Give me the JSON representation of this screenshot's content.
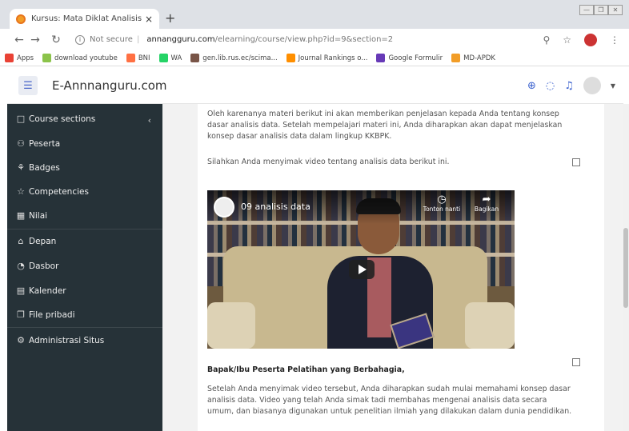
{
  "browser": {
    "tab_title": "Kursus: Mata Diklat Analisis dan",
    "tab_close": "×",
    "new_tab": "+",
    "url_security": "Not secure",
    "url_domain": "annangguru.com",
    "url_path": "/elearning/course/view.php?id=9&section=2",
    "bookmarks": [
      {
        "label": "Apps",
        "color": "#e94235"
      },
      {
        "label": "download youtube",
        "color": "#8bc34a"
      },
      {
        "label": "BNI",
        "color": "#ff7043"
      },
      {
        "label": "WA",
        "color": "#25d366"
      },
      {
        "label": "gen.lib.rus.ec/scima...",
        "color": "#795548"
      },
      {
        "label": "Journal Rankings o...",
        "color": "#ff8f00"
      },
      {
        "label": "Google Formulir",
        "color": "#673ab7"
      },
      {
        "label": "MD-APDK",
        "color": "#f29d27"
      }
    ]
  },
  "navbar": {
    "brand": "E-Annnanguru.com"
  },
  "sidebar": {
    "items": [
      {
        "label": "Course sections",
        "icon": "□"
      },
      {
        "label": "Peserta",
        "icon": "⚇"
      },
      {
        "label": "Badges",
        "icon": "⚘"
      },
      {
        "label": "Competencies",
        "icon": "☆"
      },
      {
        "label": "Nilai",
        "icon": "▦"
      },
      {
        "label": "Depan",
        "icon": "⌂"
      },
      {
        "label": "Dasbor",
        "icon": "◔"
      },
      {
        "label": "Kalender",
        "icon": "▤"
      },
      {
        "label": "File pribadi",
        "icon": "❐"
      },
      {
        "label": "Administrasi Situs",
        "icon": "⚙"
      }
    ]
  },
  "content": {
    "para1": "Oleh karenanya materi berikut ini akan memberikan penjelasan kepada Anda tentang konsep dasar analisis data. Setelah mempelajari materi ini, Anda diharapkan akan dapat menjelaskan konsep dasar analisis data dalam lingkup KKBPK.",
    "para2": "Silahkan Anda menyimak video tentang analisis data berikut ini.",
    "video_title": "09 analisis data",
    "video_watch_later": "Tonton nanti",
    "video_share": "Bagikan",
    "heading": "Bapak/Ibu Peserta Pelatihan yang Berbahagia,",
    "para3": "Setelah Anda menyimak video tersebut, Anda diharapkan sudah mulai memahami konsep dasar analisis data. Video yang telah Anda simak tadi membahas mengenai analisis data secara umum, dan biasanya digunakan untuk penelitian ilmiah yang dilakukan dalam dunia pendidikan."
  }
}
